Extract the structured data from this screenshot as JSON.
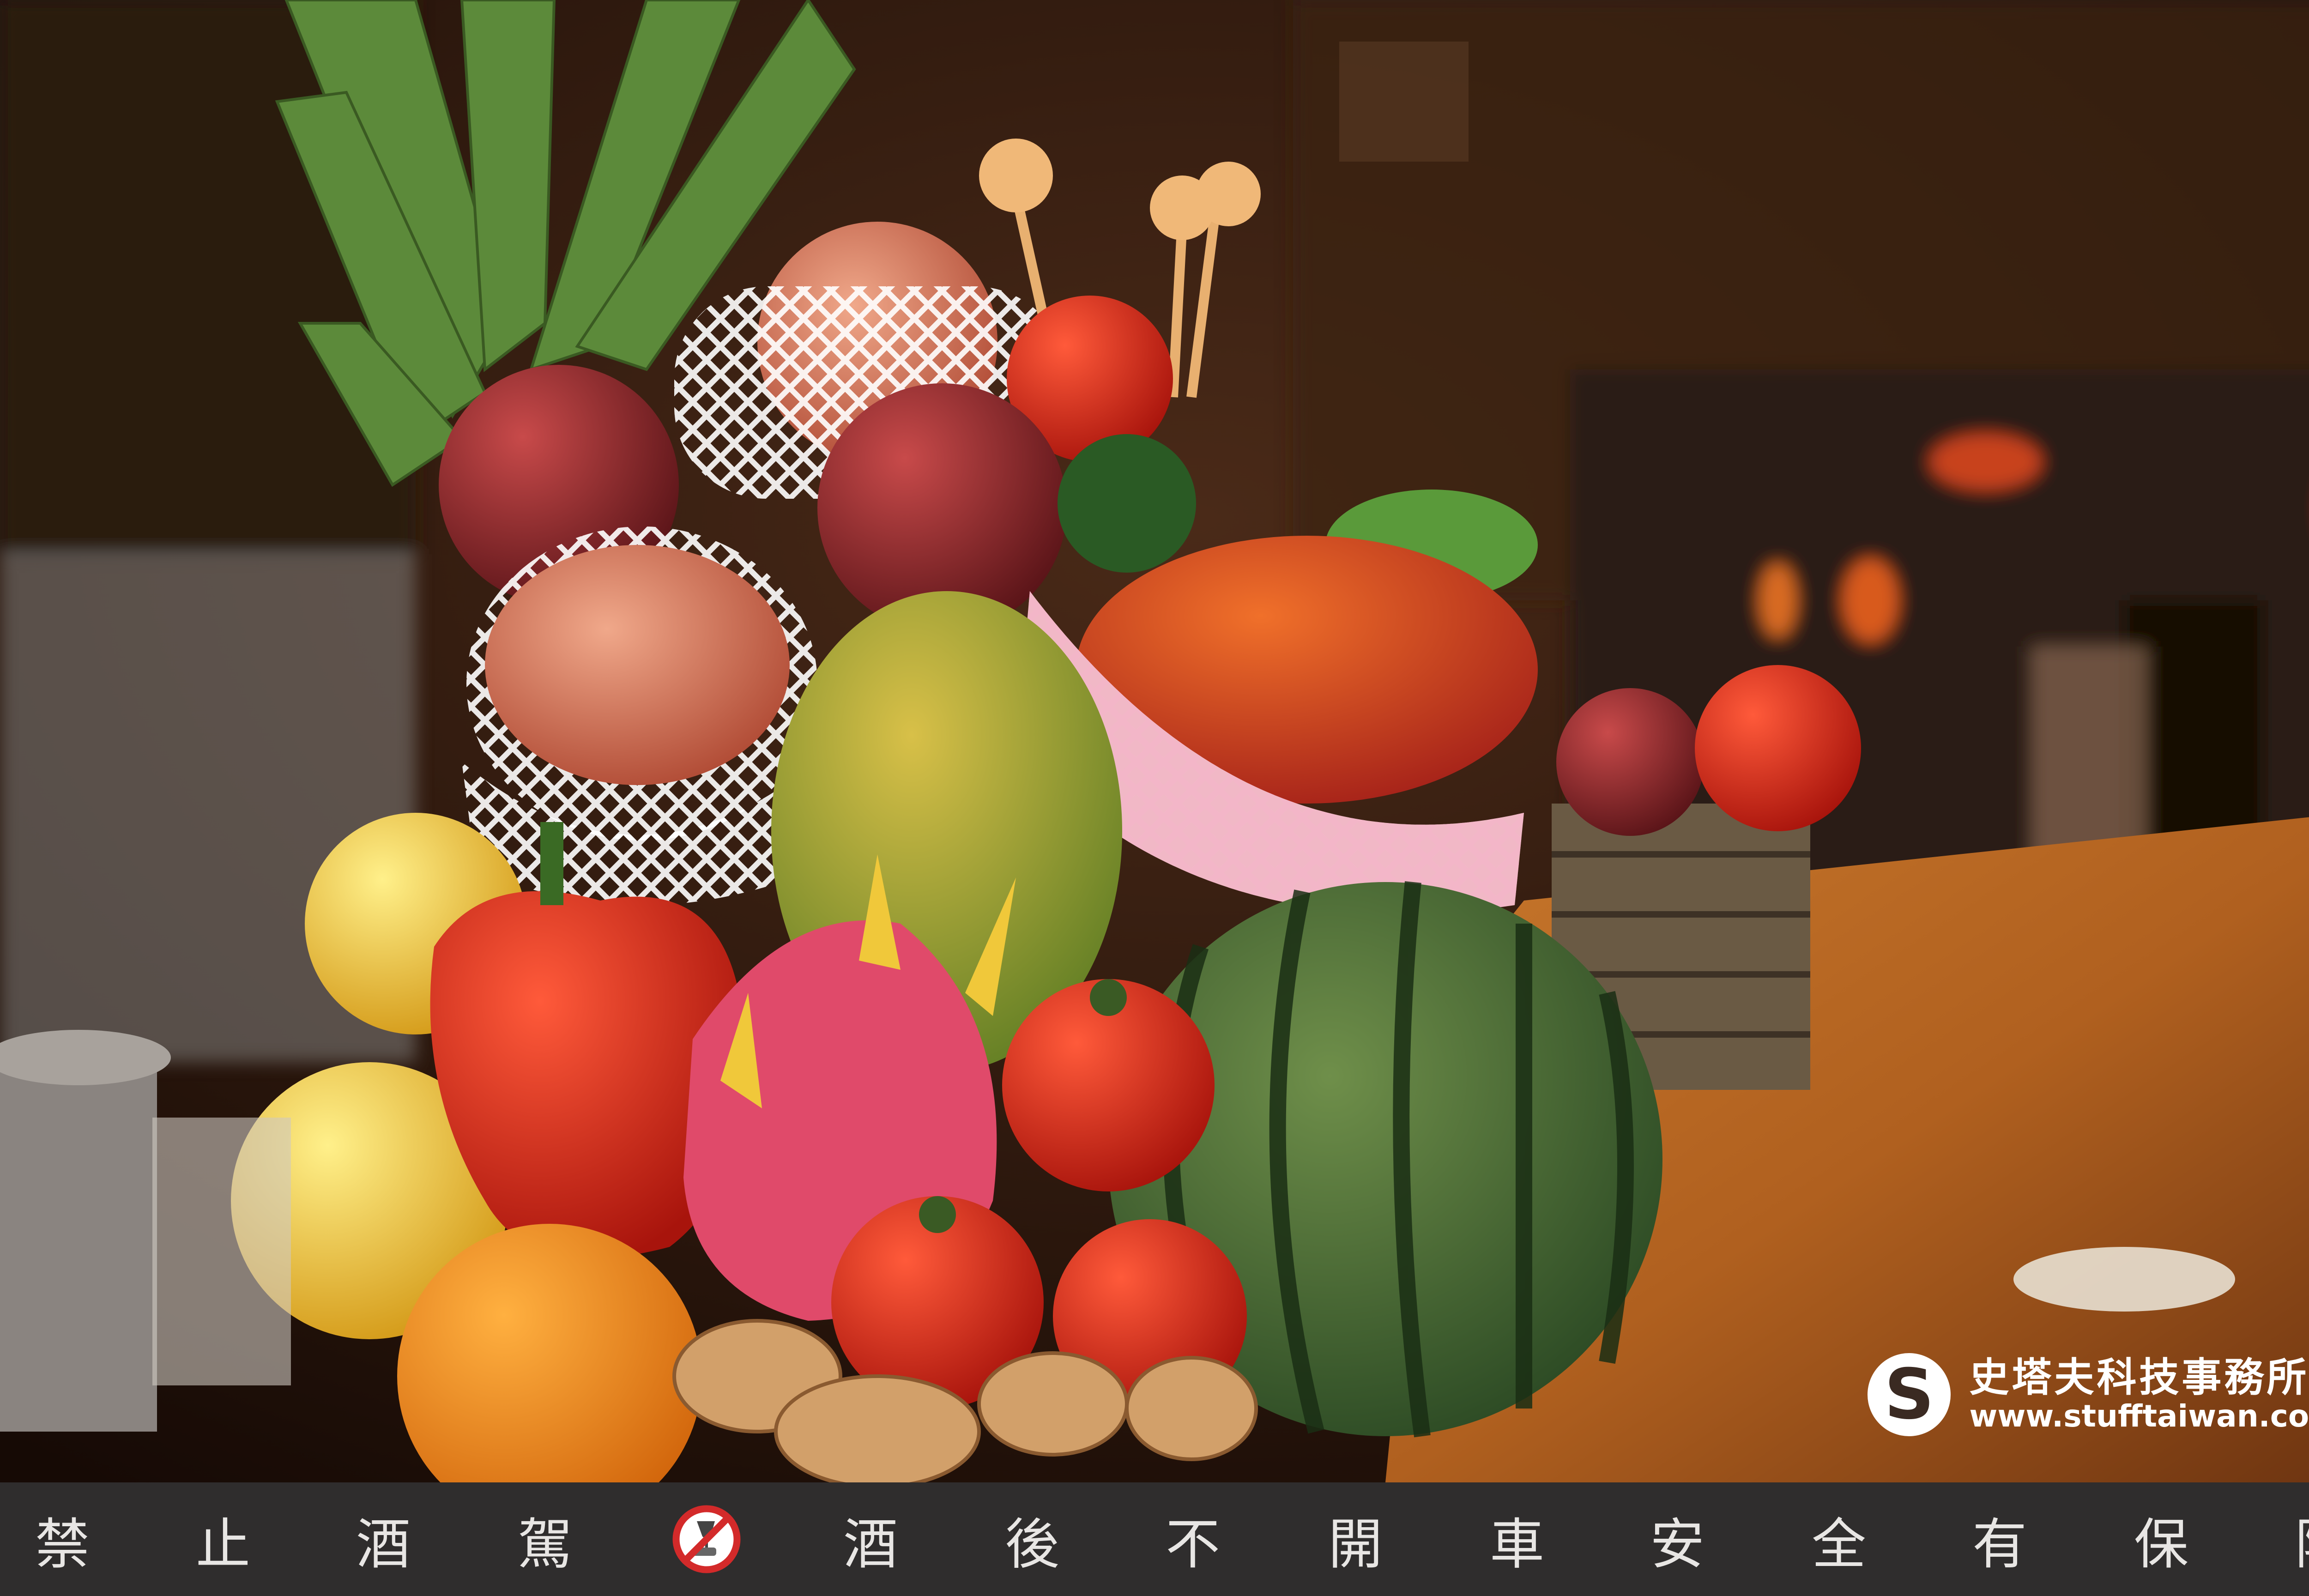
{
  "watermark": {
    "logo_letter": "S",
    "brand_cn": "史塔夫科技事務所",
    "url": "www.stufftaiwan.com"
  },
  "banner": {
    "chars": [
      "禁",
      "止",
      "酒",
      "駕",
      "酒",
      "後",
      "不",
      "開",
      "車",
      "安",
      "全",
      "有",
      "保",
      "障"
    ],
    "icon": "no-drunk-driving-icon"
  },
  "colors": {
    "banner_bg": "#2f2d2d",
    "banner_text": "#e8e6e4",
    "no_sign_red": "#d32a2a"
  }
}
